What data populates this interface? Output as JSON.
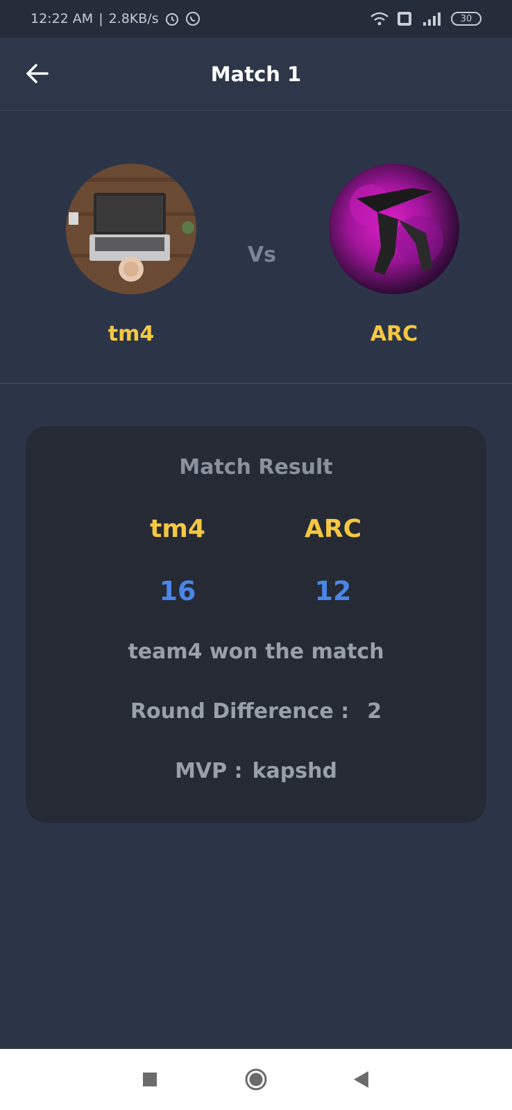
{
  "status_bar": {
    "time": "12:22 AM",
    "separator": "|",
    "speed": "2.8KB/s",
    "battery": "30",
    "icons": [
      "alarm-icon",
      "whatsapp-icon",
      "wifi-icon",
      "volte-icon",
      "signal-icon"
    ]
  },
  "app_bar": {
    "title": "Match 1",
    "back_icon": "arrow-left-icon"
  },
  "teams": {
    "left": {
      "name": "tm4",
      "avatar": "laptop-desk-photo"
    },
    "vs": "Vs",
    "right": {
      "name": "ARC",
      "avatar": "purple-smoke-soldier-photo"
    }
  },
  "result": {
    "title": "Match Result",
    "team_left": "tm4",
    "team_right": "ARC",
    "score_left": "16",
    "score_right": "12",
    "winner_text": "team4 won the match",
    "round_diff_label": "Round Difference :",
    "round_diff_value": "2",
    "mvp_label": "MVP :",
    "mvp_value": "kapshd"
  },
  "nav_bar": {
    "icons": [
      "recents-icon",
      "home-icon",
      "back-icon"
    ]
  },
  "colors": {
    "background": "#2c3548",
    "card": "#252a35",
    "team_name": "#f5c842",
    "score": "#4a86e8",
    "muted_text": "#9aa0aa"
  }
}
